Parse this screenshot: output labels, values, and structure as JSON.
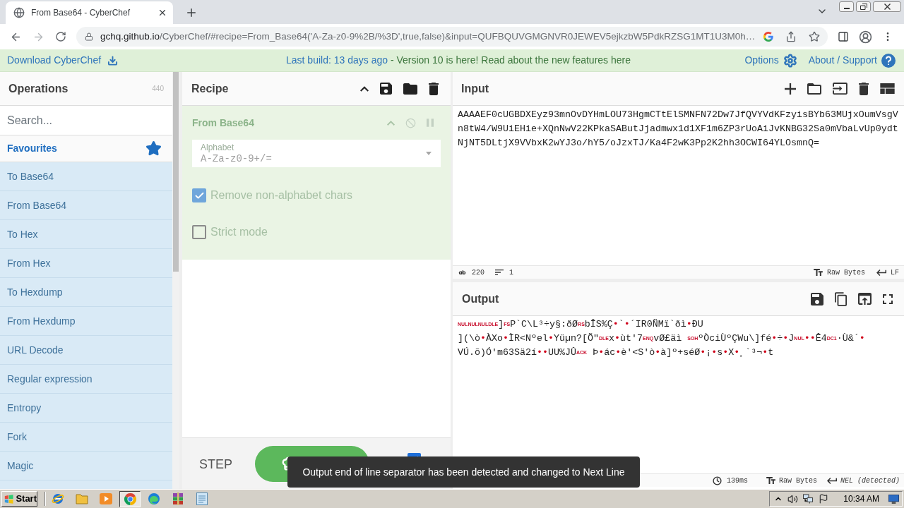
{
  "browser": {
    "tabs": [
      {
        "title": "From Base64 - CyberChef",
        "selected": true
      }
    ],
    "address": {
      "host": "gchq.github.io",
      "path": "/CyberChef/#recipe=From_Base64('A-Za-z0-9%2B/%3D',true,false)&input=QUFBQUVGMGNVR0JEWEV5ejkzbW5PdkRZSG1MT1U3M0h…"
    }
  },
  "banner": {
    "download": "Download CyberChef",
    "build": "Last build: 13 days ago",
    "news": "- Version 10 is here! Read about the new features here",
    "options": "Options",
    "about": "About / Support"
  },
  "operations": {
    "title": "Operations",
    "count": "440",
    "search": {
      "placeholder": "Search..."
    },
    "favourites": "Favourites",
    "items": [
      "To Base64",
      "From Base64",
      "To Hex",
      "From Hex",
      "To Hexdump",
      "From Hexdump",
      "URL Decode",
      "Regular expression",
      "Entropy",
      "Fork",
      "Magic"
    ]
  },
  "recipe": {
    "title": "Recipe",
    "steps": [
      {
        "name": "From Base64",
        "args": [
          {
            "kind": "select",
            "label": "Alphabet",
            "value": "A-Za-z0-9+/="
          },
          {
            "kind": "checkbox",
            "label": "Remove non-alphabet chars",
            "checked": true
          },
          {
            "kind": "checkbox",
            "label": "Strict mode",
            "checked": false
          }
        ]
      }
    ],
    "step": "STEP",
    "auto_bake": {
      "checked": true
    }
  },
  "input": {
    "title": "Input",
    "value": "AAAAEF0cUGBDXEyz93mnOvDYHmLOU73HgmCTtElSMNFN72Dw7JfQVYVdKFzyisBYb63MUjxOumVsgVn8tW4/W9UiEHie+XQnNwV22KPkaSAButJjadmwx1d1XF1m6ZP3rUoAiJvKNBG32Sa0mVbaLvUp0ydtNjNT5DLtjX9VVbxK2wYJ3o/hY5/oJzxTJ/Ka4F2wK3Pp2K2hh3OCWI64YLOsmnQ=",
    "length": "220",
    "lines": "1",
    "encoding": "Raw Bytes",
    "eol": "LF"
  },
  "output": {
    "title": "Output",
    "lines": [
      [
        {
          "kind": "control",
          "text": "NUL"
        },
        {
          "kind": "control",
          "text": "NUL"
        },
        {
          "kind": "control",
          "text": "NUL"
        },
        {
          "kind": "control",
          "text": "DLE"
        },
        {
          "kind": "text",
          "text": "]"
        },
        {
          "kind": "control",
          "text": "FS"
        },
        {
          "kind": "text",
          "text": "P`C\\L³÷y§:ðØ"
        },
        {
          "kind": "control",
          "text": "RS"
        },
        {
          "kind": "text",
          "text": "bÎS%Ç"
        },
        {
          "kind": "dot",
          "text": "•"
        },
        {
          "kind": "text",
          "text": "`"
        },
        {
          "kind": "dot",
          "text": "•"
        },
        {
          "kind": "text",
          "text": "´IR0ÑMï`ðì"
        },
        {
          "kind": "dot",
          "text": "•"
        },
        {
          "kind": "text",
          "text": "ÐU"
        }
      ],
      [
        {
          "kind": "text",
          "text": "](\\ò"
        },
        {
          "kind": "dot",
          "text": "•"
        },
        {
          "kind": "text",
          "text": "ÀXo"
        },
        {
          "kind": "dot",
          "text": "•"
        },
        {
          "kind": "text",
          "text": "ÌR<Nºel"
        },
        {
          "kind": "dot",
          "text": "•"
        },
        {
          "kind": "text",
          "text": "Yüµn?[Õ\""
        },
        {
          "kind": "control",
          "text": "DLE"
        },
        {
          "kind": "text",
          "text": "x"
        },
        {
          "kind": "dot",
          "text": "•"
        },
        {
          "kind": "text",
          "text": "ùt'7"
        },
        {
          "kind": "control",
          "text": "ENQ"
        },
        {
          "kind": "text",
          "text": "vØ£äì "
        },
        {
          "kind": "control",
          "text": "SOH"
        },
        {
          "kind": "text",
          "text": "ºÒciÙºÇWu\\]fé"
        },
        {
          "kind": "dot",
          "text": "•"
        },
        {
          "kind": "text",
          "text": "÷"
        },
        {
          "kind": "dot",
          "text": "•"
        },
        {
          "kind": "text",
          "text": "J"
        },
        {
          "kind": "control",
          "text": "NUL"
        },
        {
          "kind": "dot",
          "text": "•"
        },
        {
          "kind": "dot",
          "text": "•"
        },
        {
          "kind": "text",
          "text": "Ê4"
        },
        {
          "kind": "control",
          "text": "DC1"
        },
        {
          "kind": "text",
          "text": "·Ù&´"
        },
        {
          "kind": "dot",
          "text": "•"
        }
      ],
      [
        {
          "kind": "text",
          "text": "VÚ.õ)Ó'm63Sä2í"
        },
        {
          "kind": "dot",
          "text": "•"
        },
        {
          "kind": "dot",
          "text": "•"
        },
        {
          "kind": "text",
          "text": "UU%JÛ"
        },
        {
          "kind": "control",
          "text": "ACK"
        },
        {
          "kind": "text",
          "text": " Þ"
        },
        {
          "kind": "dot",
          "text": "•"
        },
        {
          "kind": "text",
          "text": "ác"
        },
        {
          "kind": "dot",
          "text": "•"
        },
        {
          "kind": "text",
          "text": "è'<S'ò"
        },
        {
          "kind": "dot",
          "text": "•"
        },
        {
          "kind": "text",
          "text": "à]º+séØ"
        },
        {
          "kind": "dot",
          "text": "•"
        },
        {
          "kind": "text",
          "text": "¡"
        },
        {
          "kind": "dot",
          "text": "•"
        },
        {
          "kind": "text",
          "text": "s"
        },
        {
          "kind": "dot",
          "text": "•"
        },
        {
          "kind": "text",
          "text": "X"
        },
        {
          "kind": "dot",
          "text": "•"
        },
        {
          "kind": "text",
          "text": "¸`³¬"
        },
        {
          "kind": "dot",
          "text": "•"
        },
        {
          "kind": "text",
          "text": "t"
        }
      ]
    ],
    "time": "139ms",
    "encoding": "Raw Bytes",
    "eol": "NEL (detected)"
  },
  "toast": "Output end of line separator has been detected and changed to Next Line",
  "taskbar": {
    "start": "Start",
    "apps": [
      {
        "kind": "ie",
        "selected": false
      },
      {
        "kind": "folder",
        "selected": false
      },
      {
        "kind": "media",
        "selected": false
      },
      {
        "kind": "chrome",
        "selected": true
      },
      {
        "kind": "edge",
        "selected": false
      },
      {
        "kind": "archive",
        "selected": false
      },
      {
        "kind": "notepad",
        "selected": false
      }
    ],
    "time": "10:34 AM"
  }
}
